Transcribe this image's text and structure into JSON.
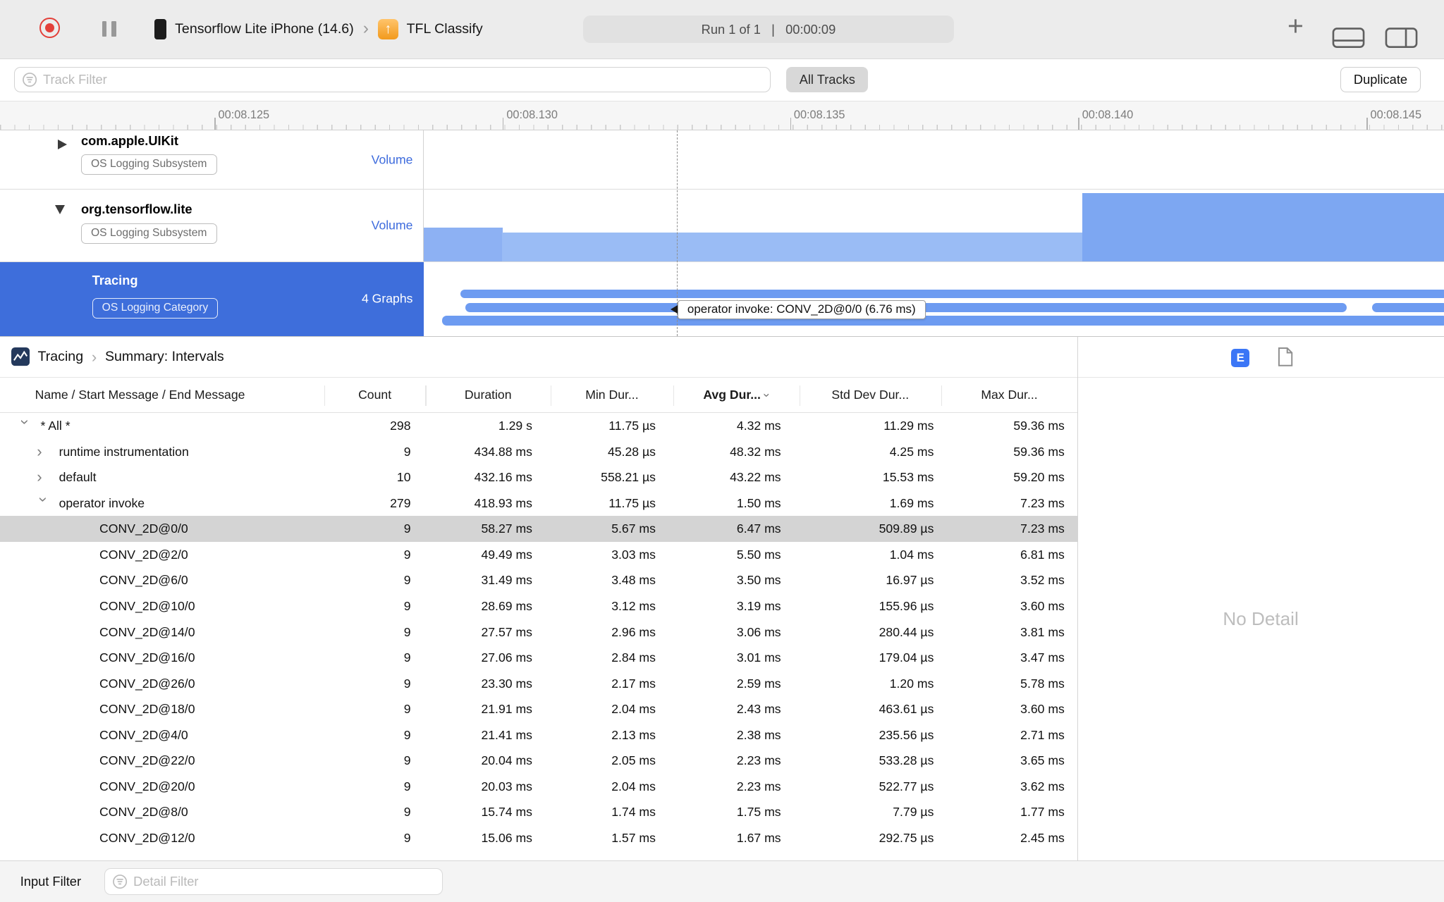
{
  "toolbar": {
    "device_name": "Tensorflow Lite iPhone (14.6)",
    "app_name": "TFL Classify",
    "run_status": "Run 1 of 1   |   00:00:09"
  },
  "filter_bar": {
    "track_filter_placeholder": "Track Filter",
    "all_tracks_label": "All Tracks",
    "duplicate_label": "Duplicate"
  },
  "timeline": {
    "ticks": [
      "00:08.125",
      "00:08.130",
      "00:08.135",
      "00:08.140",
      "00:08.145"
    ]
  },
  "tracks": [
    {
      "name": "com.apple.UIKit",
      "badge": "OS Logging Subsystem",
      "meta": "Volume",
      "expanded": false,
      "selected": false
    },
    {
      "name": "org.tensorflow.lite",
      "badge": "OS Logging Subsystem",
      "meta": "Volume",
      "expanded": true,
      "selected": false
    },
    {
      "name": "Tracing",
      "badge": "OS Logging Category",
      "meta": "4 Graphs",
      "expanded": false,
      "selected": true
    }
  ],
  "tooltip_text": "operator invoke: CONV_2D@0/0 (6.76 ms)",
  "summary": {
    "breadcrumb_root": "Tracing",
    "breadcrumb_page": "Summary: Intervals",
    "extended_detail_label": "E"
  },
  "table": {
    "headers": {
      "name": "Name / Start Message / End Message",
      "count": "Count",
      "duration": "Duration",
      "min": "Min Dur...",
      "avg": "Avg Dur...",
      "std": "Std Dev Dur...",
      "max": "Max Dur..."
    },
    "rows": [
      {
        "name": "* All *",
        "level": 0,
        "disclosure": "expanded",
        "count": "298",
        "duration": "1.29 s",
        "min": "11.75 µs",
        "avg": "4.32 ms",
        "std": "11.29 ms",
        "max": "59.36 ms",
        "selected": false
      },
      {
        "name": "runtime instrumentation",
        "level": 1,
        "disclosure": "collapsed",
        "count": "9",
        "duration": "434.88 ms",
        "min": "45.28 µs",
        "avg": "48.32 ms",
        "std": "4.25 ms",
        "max": "59.36 ms",
        "selected": false
      },
      {
        "name": "default",
        "level": 1,
        "disclosure": "collapsed",
        "count": "10",
        "duration": "432.16 ms",
        "min": "558.21 µs",
        "avg": "43.22 ms",
        "std": "15.53 ms",
        "max": "59.20 ms",
        "selected": false
      },
      {
        "name": "operator invoke",
        "level": 1,
        "disclosure": "expanded",
        "count": "279",
        "duration": "418.93 ms",
        "min": "11.75 µs",
        "avg": "1.50 ms",
        "std": "1.69 ms",
        "max": "7.23 ms",
        "selected": false
      },
      {
        "name": "CONV_2D@0/0",
        "level": 2,
        "disclosure": null,
        "count": "9",
        "duration": "58.27 ms",
        "min": "5.67 ms",
        "avg": "6.47 ms",
        "std": "509.89 µs",
        "max": "7.23 ms",
        "selected": true
      },
      {
        "name": "CONV_2D@2/0",
        "level": 2,
        "disclosure": null,
        "count": "9",
        "duration": "49.49 ms",
        "min": "3.03 ms",
        "avg": "5.50 ms",
        "std": "1.04 ms",
        "max": "6.81 ms",
        "selected": false
      },
      {
        "name": "CONV_2D@6/0",
        "level": 2,
        "disclosure": null,
        "count": "9",
        "duration": "31.49 ms",
        "min": "3.48 ms",
        "avg": "3.50 ms",
        "std": "16.97 µs",
        "max": "3.52 ms",
        "selected": false
      },
      {
        "name": "CONV_2D@10/0",
        "level": 2,
        "disclosure": null,
        "count": "9",
        "duration": "28.69 ms",
        "min": "3.12 ms",
        "avg": "3.19 ms",
        "std": "155.96 µs",
        "max": "3.60 ms",
        "selected": false
      },
      {
        "name": "CONV_2D@14/0",
        "level": 2,
        "disclosure": null,
        "count": "9",
        "duration": "27.57 ms",
        "min": "2.96 ms",
        "avg": "3.06 ms",
        "std": "280.44 µs",
        "max": "3.81 ms",
        "selected": false
      },
      {
        "name": "CONV_2D@16/0",
        "level": 2,
        "disclosure": null,
        "count": "9",
        "duration": "27.06 ms",
        "min": "2.84 ms",
        "avg": "3.01 ms",
        "std": "179.04 µs",
        "max": "3.47 ms",
        "selected": false
      },
      {
        "name": "CONV_2D@26/0",
        "level": 2,
        "disclosure": null,
        "count": "9",
        "duration": "23.30 ms",
        "min": "2.17 ms",
        "avg": "2.59 ms",
        "std": "1.20 ms",
        "max": "5.78 ms",
        "selected": false
      },
      {
        "name": "CONV_2D@18/0",
        "level": 2,
        "disclosure": null,
        "count": "9",
        "duration": "21.91 ms",
        "min": "2.04 ms",
        "avg": "2.43 ms",
        "std": "463.61 µs",
        "max": "3.60 ms",
        "selected": false
      },
      {
        "name": "CONV_2D@4/0",
        "level": 2,
        "disclosure": null,
        "count": "9",
        "duration": "21.41 ms",
        "min": "2.13 ms",
        "avg": "2.38 ms",
        "std": "235.56 µs",
        "max": "2.71 ms",
        "selected": false
      },
      {
        "name": "CONV_2D@22/0",
        "level": 2,
        "disclosure": null,
        "count": "9",
        "duration": "20.04 ms",
        "min": "2.05 ms",
        "avg": "2.23 ms",
        "std": "533.28 µs",
        "max": "3.65 ms",
        "selected": false
      },
      {
        "name": "CONV_2D@20/0",
        "level": 2,
        "disclosure": null,
        "count": "9",
        "duration": "20.03 ms",
        "min": "2.04 ms",
        "avg": "2.23 ms",
        "std": "522.77 µs",
        "max": "3.62 ms",
        "selected": false
      },
      {
        "name": "CONV_2D@8/0",
        "level": 2,
        "disclosure": null,
        "count": "9",
        "duration": "15.74 ms",
        "min": "1.74 ms",
        "avg": "1.75 ms",
        "std": "7.79 µs",
        "max": "1.77 ms",
        "selected": false
      },
      {
        "name": "CONV_2D@12/0",
        "level": 2,
        "disclosure": null,
        "count": "9",
        "duration": "15.06 ms",
        "min": "1.57 ms",
        "avg": "1.67 ms",
        "std": "292.75 µs",
        "max": "2.45 ms",
        "selected": false
      }
    ]
  },
  "detail_panel": {
    "empty_text": "No Detail"
  },
  "bottom_bar": {
    "label": "Input Filter",
    "detail_filter_placeholder": "Detail Filter"
  },
  "icons": {
    "plus": "+",
    "chevron": "›",
    "sort_chevron": "›",
    "app_arrow": "↑"
  },
  "colors": {
    "selection_blue": "#3e6edb",
    "volume_label_blue": "#3d6bdd",
    "lane_blue": "#6d9bf1",
    "bar_light": "#9abcf5",
    "bar_medium": "#8db1f3",
    "bar_tall": "#7da7f2",
    "extended_detail_badge": "#3b76f6",
    "record_red": "#e3403a"
  }
}
